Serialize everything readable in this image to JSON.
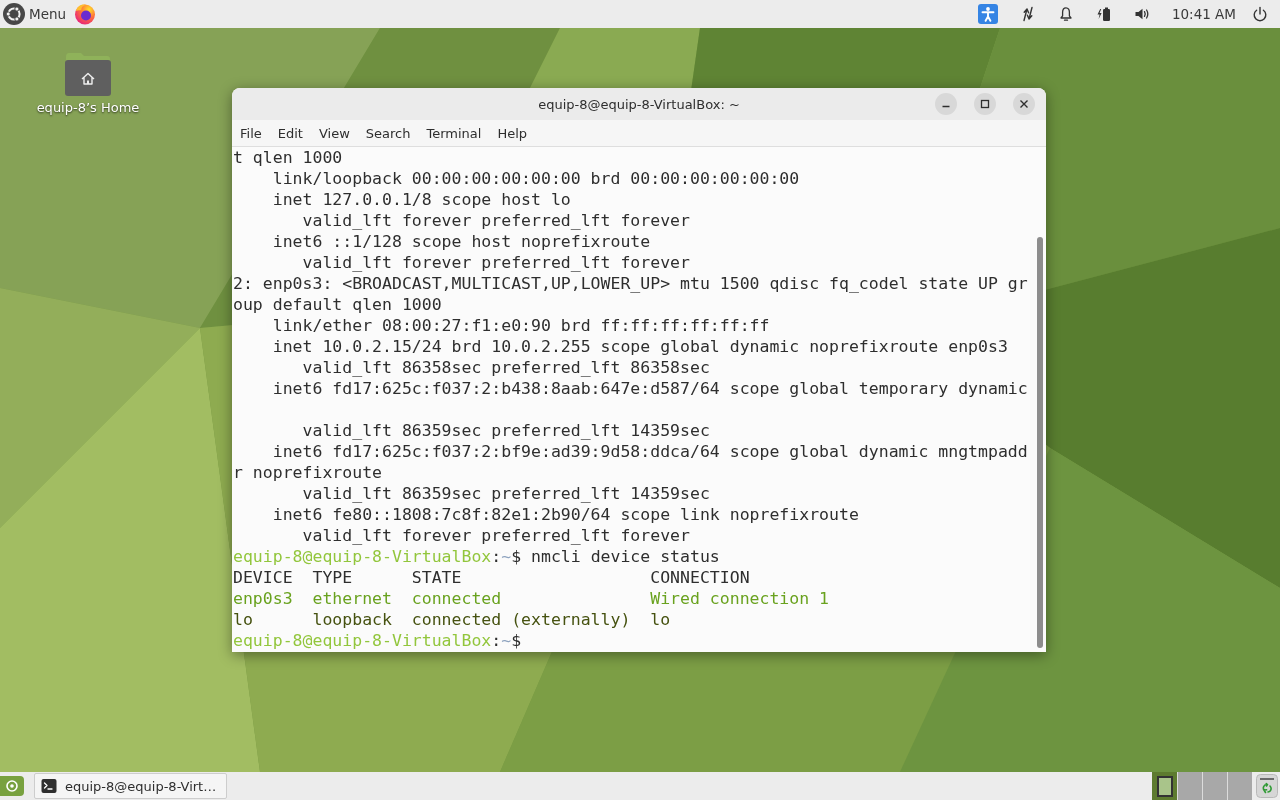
{
  "top_panel": {
    "menu_label": "Menu",
    "clock": "10:41 AM"
  },
  "desktop_icons": [
    {
      "label": "equip-8’s Home"
    }
  ],
  "terminal": {
    "title": "equip-8@equip-8-VirtualBox: ~",
    "menu": [
      "File",
      "Edit",
      "View",
      "Search",
      "Terminal",
      "Help"
    ],
    "lines": [
      {
        "kind": "output",
        "segments": [
          {
            "text": "t qlen 1000",
            "kind": "plain"
          }
        ]
      },
      {
        "kind": "output",
        "segments": [
          {
            "text": "    link/loopback 00:00:00:00:00:00 brd 00:00:00:00:00:00",
            "kind": "plain"
          }
        ]
      },
      {
        "kind": "output",
        "segments": [
          {
            "text": "    inet 127.0.0.1/8 scope host lo",
            "kind": "plain"
          }
        ]
      },
      {
        "kind": "output",
        "segments": [
          {
            "text": "       valid_lft forever preferred_lft forever",
            "kind": "plain"
          }
        ]
      },
      {
        "kind": "output",
        "segments": [
          {
            "text": "    inet6 ::1/128 scope host noprefixroute",
            "kind": "plain"
          }
        ]
      },
      {
        "kind": "output",
        "segments": [
          {
            "text": "       valid_lft forever preferred_lft forever",
            "kind": "plain"
          }
        ]
      },
      {
        "kind": "output",
        "segments": [
          {
            "text": "2: enp0s3: <BROADCAST,MULTICAST,UP,LOWER_UP> mtu 1500 qdisc fq_codel state UP gr",
            "kind": "plain"
          }
        ]
      },
      {
        "kind": "output",
        "segments": [
          {
            "text": "oup default qlen 1000",
            "kind": "plain"
          }
        ]
      },
      {
        "kind": "output",
        "segments": [
          {
            "text": "    link/ether 08:00:27:f1:e0:90 brd ff:ff:ff:ff:ff:ff",
            "kind": "plain"
          }
        ]
      },
      {
        "kind": "output",
        "segments": [
          {
            "text": "    inet 10.0.2.15/24 brd 10.0.2.255 scope global dynamic noprefixroute enp0s3",
            "kind": "plain"
          }
        ]
      },
      {
        "kind": "output",
        "segments": [
          {
            "text": "       valid_lft 86358sec preferred_lft 86358sec",
            "kind": "plain"
          }
        ]
      },
      {
        "kind": "output",
        "segments": [
          {
            "text": "    inet6 fd17:625c:f037:2:b438:8aab:647e:d587/64 scope global temporary dynamic",
            "kind": "plain"
          }
        ]
      },
      {
        "kind": "blank"
      },
      {
        "kind": "output",
        "segments": [
          {
            "text": "       valid_lft 86359sec preferred_lft 14359sec",
            "kind": "plain"
          }
        ]
      },
      {
        "kind": "output",
        "segments": [
          {
            "text": "    inet6 fd17:625c:f037:2:bf9e:ad39:9d58:ddca/64 scope global dynamic mngtmpadd",
            "kind": "plain"
          }
        ]
      },
      {
        "kind": "output",
        "segments": [
          {
            "text": "r noprefixroute",
            "kind": "plain"
          }
        ]
      },
      {
        "kind": "output",
        "segments": [
          {
            "text": "       valid_lft 86359sec preferred_lft 14359sec",
            "kind": "plain"
          }
        ]
      },
      {
        "kind": "output",
        "segments": [
          {
            "text": "    inet6 fe80::1808:7c8f:82e1:2b90/64 scope link noprefixroute",
            "kind": "plain"
          }
        ]
      },
      {
        "kind": "output",
        "segments": [
          {
            "text": "       valid_lft forever preferred_lft forever",
            "kind": "plain"
          }
        ]
      },
      {
        "kind": "prompt",
        "segments": [
          {
            "text": "equip-8@equip-8-VirtualBox",
            "kind": "user"
          },
          {
            "text": ":",
            "kind": "plain"
          },
          {
            "text": "~",
            "kind": "path"
          },
          {
            "text": "$ nmcli device status",
            "kind": "plain"
          }
        ]
      },
      {
        "kind": "output",
        "segments": [
          {
            "text": "DEVICE  TYPE      STATE                   CONNECTION",
            "kind": "plain"
          }
        ]
      },
      {
        "kind": "output",
        "segments": [
          {
            "text": "enp0s3  ethernet  connected               Wired connection 1",
            "kind": "connected"
          }
        ]
      },
      {
        "kind": "output",
        "segments": [
          {
            "text": "lo      loopback  connected (externally)  lo",
            "kind": "external"
          }
        ]
      },
      {
        "kind": "prompt",
        "segments": [
          {
            "text": "equip-8@equip-8-VirtualBox",
            "kind": "user"
          },
          {
            "text": ":",
            "kind": "plain"
          },
          {
            "text": "~",
            "kind": "path"
          },
          {
            "text": "$",
            "kind": "plain"
          }
        ]
      }
    ]
  },
  "taskbar": {
    "windows": [
      {
        "title": "equip-8@equip-8-Virt…"
      }
    ],
    "workspaces": [
      {
        "selected": true,
        "has_window": true
      },
      {
        "selected": false,
        "has_window": false
      },
      {
        "selected": false,
        "has_window": false
      },
      {
        "selected": false,
        "has_window": false
      }
    ]
  }
}
